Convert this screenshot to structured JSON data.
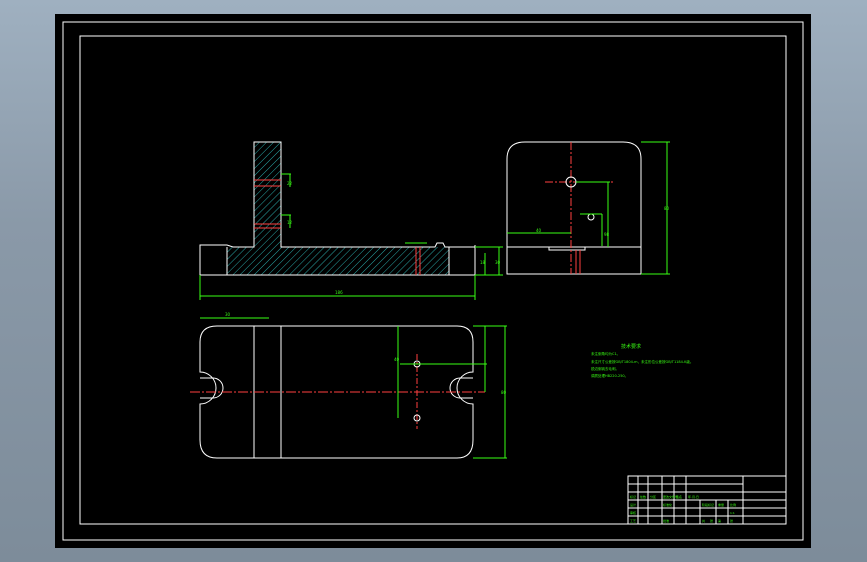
{
  "drawing": {
    "tech_requirements_title": "技术要求",
    "tech_requirements": [
      "未注倒角均为C1。",
      "未注尺寸公差按GB/T1804-m，未注形位公差按GB/T1184-K级。",
      "锐边倒钝去毛刺。",
      "调质处理HB220-250。"
    ],
    "dimensions": {
      "front_overall_length": "186",
      "front_step_height": "18",
      "front_base_height": "30",
      "front_slot_width": "12",
      "front_hole_pitch": "22",
      "side_height": "80",
      "side_width": "98",
      "side_offset": "40",
      "top_slot_offset": "30",
      "top_hole_spacing": "40",
      "top_width": "80"
    },
    "title_block": {
      "row1": [
        "标记",
        "处数",
        "分区",
        "更改文件号",
        "签名",
        "年.月.日"
      ],
      "row2": [
        "设计",
        "",
        "标准化",
        "",
        "阶段标记",
        "重量",
        "比例"
      ],
      "row3": [
        "审核",
        "",
        "",
        "",
        "",
        "",
        "1:1"
      ],
      "row4": [
        "工艺",
        "",
        "批准",
        "",
        "共",
        "张",
        "第",
        "张"
      ]
    }
  }
}
